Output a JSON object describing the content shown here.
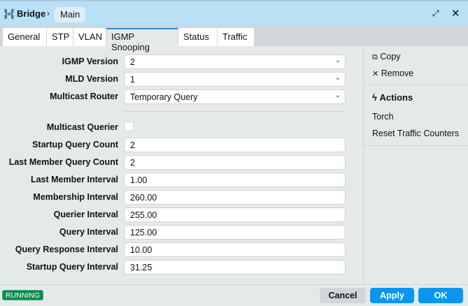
{
  "titlebar": {
    "crumb_parent": "Bridge",
    "crumb_separator": "›",
    "crumb_current": "Main",
    "maximize_icon": "maximize-icon",
    "close_icon": "close-icon"
  },
  "tabs": [
    {
      "label": "General"
    },
    {
      "label": "STP"
    },
    {
      "label": "VLAN"
    },
    {
      "label": "IGMP Snooping"
    },
    {
      "label": "Status"
    },
    {
      "label": "Traffic"
    }
  ],
  "active_tab": "IGMP Snooping",
  "form": {
    "igmp_version": {
      "label": "IGMP Version",
      "value": "2"
    },
    "mld_version": {
      "label": "MLD Version",
      "value": "1"
    },
    "multicast_router": {
      "label": "Multicast Router",
      "value": "Temporary Query"
    },
    "multicast_querier": {
      "label": "Multicast Querier",
      "checked": false
    },
    "startup_query_count": {
      "label": "Startup Query Count",
      "value": "2"
    },
    "last_member_query_count": {
      "label": "Last Member Query Count",
      "value": "2"
    },
    "last_member_interval": {
      "label": "Last Member Interval",
      "value": "1.00"
    },
    "membership_interval": {
      "label": "Membership Interval",
      "value": "260.00"
    },
    "querier_interval": {
      "label": "Querier Interval",
      "value": "255.00"
    },
    "query_interval": {
      "label": "Query Interval",
      "value": "125.00"
    },
    "query_response_interval": {
      "label": "Query Response Interval",
      "value": "10.00"
    },
    "startup_query_interval": {
      "label": "Startup Query Interval",
      "value": "31.25"
    }
  },
  "side": {
    "copy": "Copy",
    "remove": "Remove",
    "actions_title": "Actions",
    "torch": "Torch",
    "reset_counters": "Reset Traffic Counters"
  },
  "footer": {
    "status": "RUNNING",
    "cancel": "Cancel",
    "apply": "Apply",
    "ok": "OK"
  },
  "colors": {
    "accent": "#0a96f0",
    "titlebar": "#b9e0f5",
    "running": "#0e8a4f"
  }
}
